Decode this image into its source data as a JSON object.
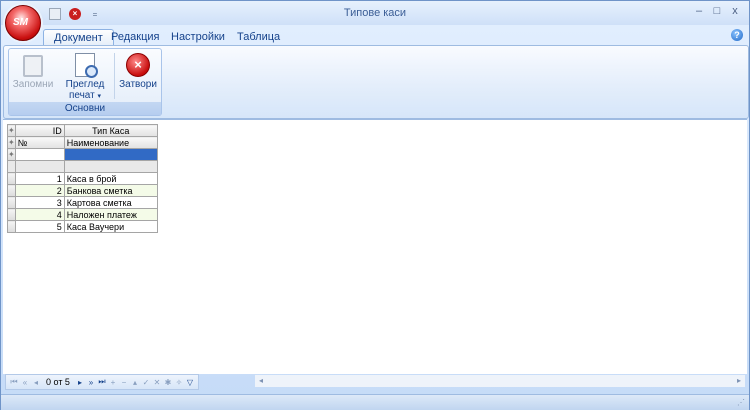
{
  "app": {
    "title": "Типове каси",
    "orb_label": "SM",
    "window_controls": [
      "–",
      "□",
      "x"
    ]
  },
  "tabs": [
    "Документ",
    "Редакция",
    "Настройки",
    "Таблица"
  ],
  "ribbon": {
    "group_caption": "Основни",
    "buttons": {
      "save": "Запомни",
      "preview_line1": "Преглед",
      "preview_line2": "печат",
      "close": "Затвори"
    }
  },
  "grid": {
    "headers": {
      "id": "ID",
      "type": "Тип Каса"
    },
    "subheaders": {
      "num": "№",
      "name": "Наименование"
    },
    "rows": [
      {
        "id": "1",
        "name": "Каса в брой"
      },
      {
        "id": "2",
        "name": "Банкова сметка"
      },
      {
        "id": "3",
        "name": "Картова сметка"
      },
      {
        "id": "4",
        "name": "Наложен платеж"
      },
      {
        "id": "5",
        "name": "Каса Ваучери"
      }
    ]
  },
  "navigator": {
    "position": "0 от 5",
    "icons": [
      "first-icon",
      "prev-page-icon",
      "prev-icon",
      "next-icon",
      "next-page-icon",
      "last-icon",
      "append-icon",
      "delete-icon",
      "edit-icon",
      "post-icon",
      "cancel-icon",
      "refresh-icon",
      "bookmark-icon",
      "filter-icon"
    ]
  },
  "colors": {
    "selection": "#316ac5",
    "accent": "#15428b",
    "close_red": "#c80d0d"
  }
}
